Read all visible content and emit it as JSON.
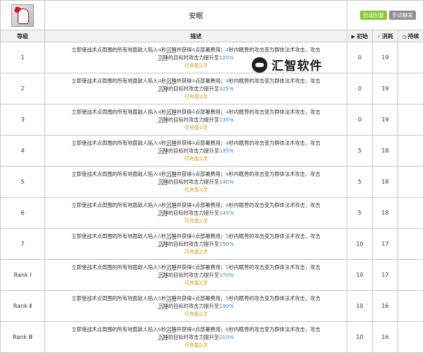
{
  "skill": {
    "name": "安眠",
    "tags": [
      "自动回复",
      "手动触发"
    ]
  },
  "columns": {
    "level": "等级",
    "desc": "描述",
    "initial": "初始",
    "cost": "消耗",
    "duration": "持续"
  },
  "icons": {
    "initial": "play-icon",
    "cost": "bolt-icon",
    "duration": "clock-icon"
  },
  "colors": {
    "highlight": "#2f7fd1",
    "charge": "#d49a1a",
    "tag_auto": "#8ac833",
    "tag_manual": "#8f8f8f"
  },
  "desc_parts": {
    "p1": "立即使战术点周围的所有地面敌人陷入",
    "p2": "秒",
    "p3": "沉睡",
    "p4": "并获得",
    "p5": "点部署费用；",
    "p6": "秒内眠兽的攻击变为群体法术攻击，攻击",
    "p7": "沉睡",
    "p8": "的目标时攻击力提升至"
  },
  "rows": [
    {
      "level": "1",
      "sleep": "4",
      "dp": "4",
      "dur_text": "4",
      "atk": "120%",
      "charge": "可充能1次",
      "initial": "0",
      "cost": "19",
      "duration": ""
    },
    {
      "level": "2",
      "sleep": "4",
      "dp": "4",
      "dur_text": "4",
      "atk": "125%",
      "charge": "可充能1次",
      "initial": "0",
      "cost": "19",
      "duration": ""
    },
    {
      "level": "3",
      "sleep": "4",
      "dp": "4",
      "dur_text": "4",
      "atk": "130%",
      "charge": "可充能1次",
      "initial": "0",
      "cost": "19",
      "duration": ""
    },
    {
      "level": "4",
      "sleep": "4",
      "dp": "4",
      "dur_text": "4",
      "atk": "135%",
      "charge": "可充能1次",
      "initial": "5",
      "cost": "18",
      "duration": ""
    },
    {
      "level": "5",
      "sleep": "4",
      "dp": "4",
      "dur_text": "4",
      "atk": "140%",
      "charge": "可充能1次",
      "initial": "5",
      "cost": "18",
      "duration": ""
    },
    {
      "level": "6",
      "sleep": "4",
      "dp": "4",
      "dur_text": "4",
      "atk": "145%",
      "charge": "可充能1次",
      "initial": "5",
      "cost": "18",
      "duration": ""
    },
    {
      "level": "7",
      "sleep": "5",
      "dp": "4",
      "dur_text": "5",
      "atk": "150%",
      "charge": "可充能2次",
      "initial": "10",
      "cost": "17",
      "duration": ""
    },
    {
      "level": "Rank Ⅰ",
      "sleep": "5",
      "dp": "4",
      "dur_text": "5",
      "atk": "170%",
      "charge": "可充能2次",
      "initial": "10",
      "cost": "17",
      "duration": ""
    },
    {
      "level": "Rank Ⅱ",
      "sleep": "5",
      "dp": "4",
      "dur_text": "5",
      "atk": "190%",
      "charge": "可充能2次",
      "initial": "10",
      "cost": "16",
      "duration": ""
    },
    {
      "level": "Rank Ⅲ",
      "sleep": "6",
      "dp": "4",
      "dur_text": "6",
      "atk": "210%",
      "charge": "可充能2次",
      "initial": "10",
      "cost": "16",
      "duration": ""
    }
  ],
  "watermark": {
    "text": "汇智软件"
  }
}
